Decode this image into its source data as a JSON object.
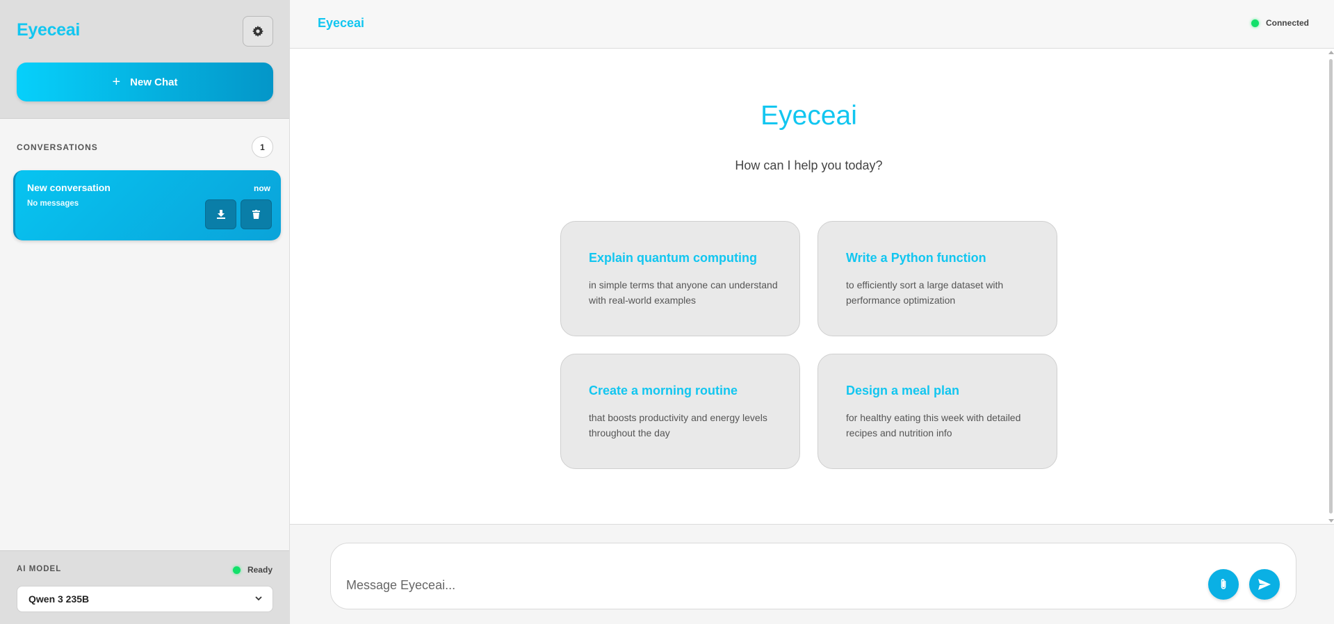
{
  "sidebar": {
    "brand": "Eyeceai",
    "new_chat_label": "New Chat",
    "conversations_label": "CONVERSATIONS",
    "conversations_count": "1",
    "conversations": [
      {
        "title": "New conversation",
        "time": "now",
        "subtitle": "No messages"
      }
    ],
    "model_label": "AI MODEL",
    "model_status": "Ready",
    "model_selected": "Qwen 3 235B"
  },
  "header": {
    "title": "Eyeceai",
    "connection_status": "Connected"
  },
  "welcome": {
    "title": "Eyeceai",
    "subtitle": "How can I help you today?"
  },
  "suggestions": [
    {
      "title": "Explain quantum computing",
      "description": "in simple terms that anyone can understand with real-world examples"
    },
    {
      "title": "Write a Python function",
      "description": "to efficiently sort a large dataset with performance optimization"
    },
    {
      "title": "Create a morning routine",
      "description": "that boosts productivity and energy levels throughout the day"
    },
    {
      "title": "Design a meal plan",
      "description": "for healthy eating this week with detailed recipes and nutrition info"
    }
  ],
  "composer": {
    "placeholder": "Message Eyeceai...",
    "value": ""
  },
  "colors": {
    "accent": "#12c6f0",
    "status_green": "#12e06a"
  },
  "icons": {
    "settings": "gear-icon",
    "new_chat": "plus-icon",
    "download": "download-icon",
    "delete": "trash-icon",
    "select": "chevron-down-icon",
    "attach": "paperclip-icon",
    "send": "send-icon"
  }
}
